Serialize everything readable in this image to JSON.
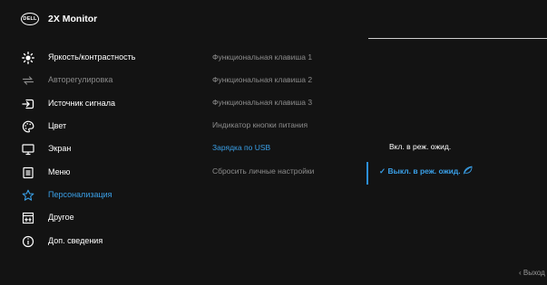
{
  "header": {
    "logo_text": "DELL",
    "title": "2X Monitor"
  },
  "menu": [
    {
      "id": "brightness",
      "label": "Яркость/контрастность",
      "icon": "brightness-icon",
      "state": "normal"
    },
    {
      "id": "auto-adjust",
      "label": "Авторегулировка",
      "icon": "auto-adjust-icon",
      "state": "dim"
    },
    {
      "id": "input-source",
      "label": "Источник сигнала",
      "icon": "input-source-icon",
      "state": "normal"
    },
    {
      "id": "color",
      "label": "Цвет",
      "icon": "palette-icon",
      "state": "normal"
    },
    {
      "id": "display",
      "label": "Экран",
      "icon": "display-icon",
      "state": "normal"
    },
    {
      "id": "menu",
      "label": "Меню",
      "icon": "menu-icon",
      "state": "normal"
    },
    {
      "id": "personalize",
      "label": "Персонализация",
      "icon": "star-icon",
      "state": "active"
    },
    {
      "id": "other",
      "label": "Другое",
      "icon": "other-icon",
      "state": "normal"
    },
    {
      "id": "info",
      "label": "Доп. сведения",
      "icon": "info-icon",
      "state": "normal"
    }
  ],
  "submenu": [
    {
      "label": "Функциональная клавиша 1",
      "state": "normal"
    },
    {
      "label": "Функциональная клавиша 2",
      "state": "normal"
    },
    {
      "label": "Функциональная клавиша 3",
      "state": "normal"
    },
    {
      "label": "Индикатор кнопки питания",
      "state": "normal"
    },
    {
      "label": "Зарядка по USB",
      "state": "active"
    },
    {
      "label": "Сбросить личные настройки",
      "state": "normal"
    }
  ],
  "options": {
    "on_in_standby": "Вкл. в реж. ожид.",
    "off_in_standby": "Выкл. в реж. ожид.",
    "selected_check": "✓"
  },
  "footer": {
    "exit_label": "Выход"
  },
  "colors": {
    "accent": "#3aa0e8",
    "background": "#131313",
    "text": "#ffffff",
    "dim_text": "#8d8d8d"
  }
}
